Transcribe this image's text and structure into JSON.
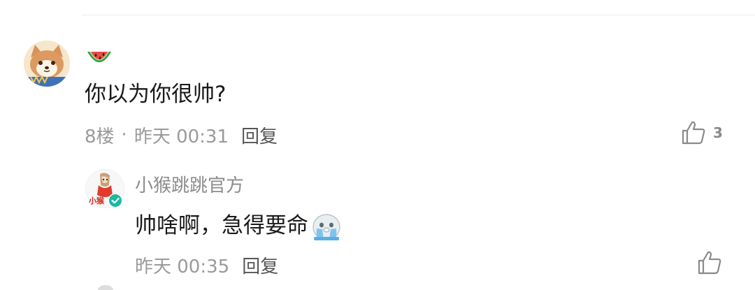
{
  "comment": {
    "badge_icon": "watermelon-icon",
    "text": "你以为你很帅?",
    "floor": "8楼",
    "separator": "·",
    "time": "昨天 00:31",
    "reply_label": "回复",
    "like_count": "3"
  },
  "reply": {
    "author": "小猴跳跳官方",
    "avatar_caption": "小猴",
    "text": "帅啥啊，急得要命",
    "emoji": "crying-seal-emoji",
    "time": "昨天 00:35",
    "reply_label": "回复"
  },
  "colors": {
    "verified": "#19b9a2",
    "text_primary": "#1a1a1a",
    "text_secondary": "#9a9a9a"
  }
}
